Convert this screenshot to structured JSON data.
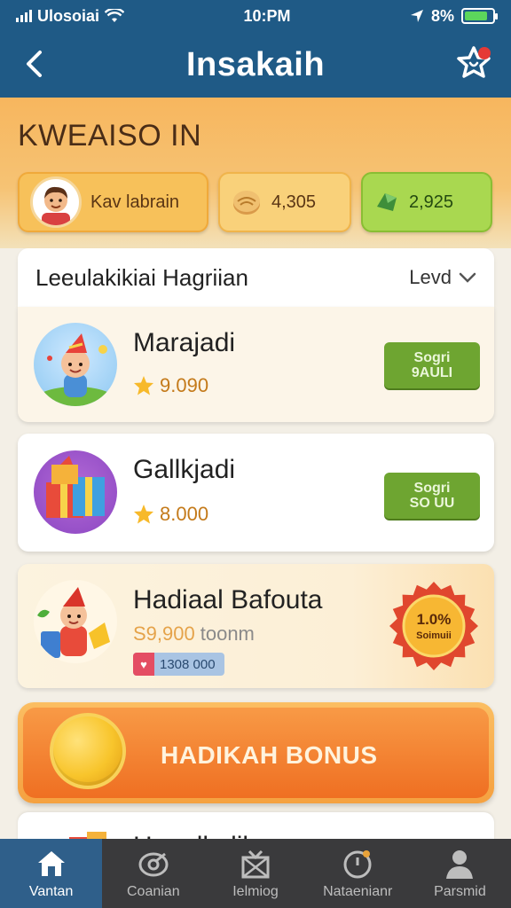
{
  "status_bar": {
    "carrier": "Ulosoiai",
    "time": "10:PM",
    "battery": "8%",
    "battery_level": 0.85
  },
  "header": {
    "title": "Insakaih",
    "back_icon": "chevron-left-icon",
    "action_icon": "star-badge-icon"
  },
  "banner": {
    "title": "KWEAISO IN",
    "user_name": "Kav labrain",
    "coins": "4,305",
    "gems": "2,925"
  },
  "list": {
    "title": "Leeulakikiai Hagriian",
    "sort_label": "Levd"
  },
  "rewards": [
    {
      "name": "Marajadi",
      "price": "9.090",
      "button_line1": "Sogri",
      "button_line2": "9AULI"
    },
    {
      "name": "Gallkjadi",
      "price": "8.000",
      "button_line1": "Sogri",
      "button_line2": "SO UU"
    },
    {
      "name": "Hadiaal Bafouta",
      "price": "S9,900",
      "price_extra": "toonm",
      "timer": "1308 000",
      "badge_line1": "1.0%",
      "badge_line2": "Soimuii"
    }
  ],
  "bonus": {
    "label": "HADIKAH BONUS"
  },
  "partial_card": {
    "name": "Haualkalil"
  },
  "nav": [
    {
      "label": "Vantan",
      "icon": "home-icon",
      "active": true
    },
    {
      "label": "Coanian",
      "icon": "target-icon",
      "active": false
    },
    {
      "label": "Ielmiog",
      "icon": "gift-icon",
      "active": false
    },
    {
      "label": "Nataenianr",
      "icon": "clock-icon",
      "active": false
    },
    {
      "label": "Parsmid",
      "icon": "profile-icon",
      "active": false
    }
  ],
  "colors": {
    "header_bg": "#1f5a86",
    "claim_green": "#6ea531",
    "bonus_orange": "#ef6f22",
    "nav_bg": "#3a3a3c"
  }
}
